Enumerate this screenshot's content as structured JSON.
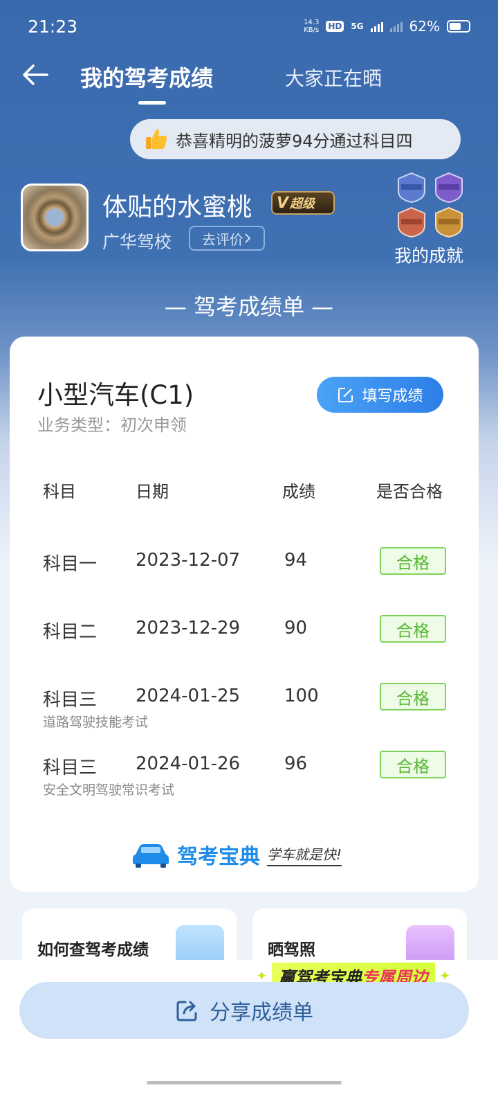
{
  "status_bar": {
    "time": "21:23",
    "net_speed_value": "14.3",
    "net_speed_unit": "KB/s",
    "hd": "HD",
    "network": "5G",
    "battery": "62%",
    "battery_level": 0.62
  },
  "header": {
    "tabs": [
      {
        "label": "我的驾考成绩",
        "active": true
      },
      {
        "label": "大家正在晒",
        "active": false
      }
    ]
  },
  "notice": {
    "text": "恭喜精明的菠萝94分通过科目四",
    "icon": "thumbs-up-icon"
  },
  "profile": {
    "name": "体贴的水蜜桃",
    "vip_letter": "V",
    "vip_label": "超级",
    "school": "广华驾校",
    "rate_button": "去评价",
    "achievement_label": "我的成就"
  },
  "report": {
    "title": "— 驾考成绩单 —",
    "license_type": "小型汽车(C1)",
    "business_type": "业务类型：初次申领",
    "fill_button": "填写成绩",
    "columns": [
      "科目",
      "日期",
      "成绩",
      "是否合格"
    ],
    "rows": [
      {
        "subject": "科目一",
        "date": "2023-12-07",
        "score": "94",
        "result": "合格",
        "note": ""
      },
      {
        "subject": "科目二",
        "date": "2023-12-29",
        "score": "90",
        "result": "合格",
        "note": ""
      },
      {
        "subject": "科目三",
        "date": "2024-01-25",
        "score": "100",
        "result": "合格",
        "note": "道路驾驶技能考试"
      },
      {
        "subject": "科目三",
        "date": "2024-01-26",
        "score": "96",
        "result": "合格",
        "note": "安全文明驾驶常识考试"
      }
    ],
    "brand_name": "驾考宝典",
    "brand_slogan": "学车就是快!"
  },
  "bottom_cards": [
    {
      "label": "如何查驾考成绩"
    },
    {
      "label": "晒驾照"
    }
  ],
  "promo": {
    "part1": "赢驾考宝典",
    "part2": "专属周边"
  },
  "share_button": "分享成绩单",
  "colors": {
    "primary_blue": "#3a6aae",
    "pass_green": "#59b734",
    "button_blue": "#2d7ee8"
  }
}
